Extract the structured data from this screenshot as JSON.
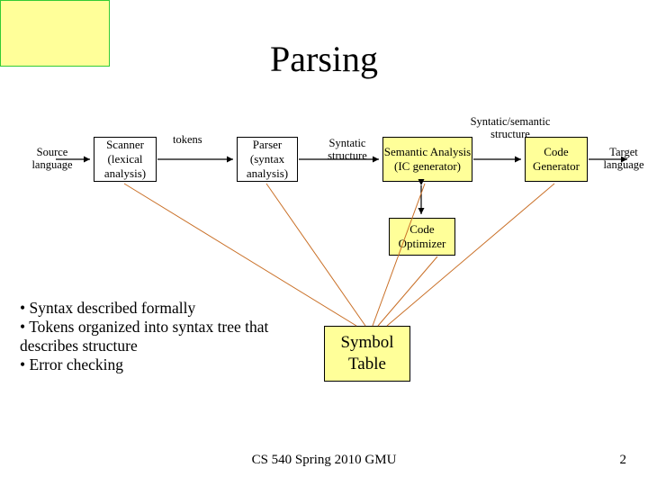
{
  "title": "Parsing",
  "labels": {
    "source": "Source language",
    "tokens": "tokens",
    "synstruct": "Syntatic structure",
    "synsem": "Syntatic/semantic structure",
    "target": "Target language"
  },
  "boxes": {
    "scanner": "Scanner (lexical analysis)",
    "parser": "Parser (syntax analysis)",
    "semantic": "Semantic Analysis (IC generator)",
    "codegen": "Code Generator",
    "optimizer": "Code Optimizer",
    "symbol": "Symbol Table"
  },
  "bullets": {
    "b1": "Syntax described formally",
    "b2": "Tokens organized into syntax tree that describes structure",
    "b3": "Error checking"
  },
  "footer": {
    "center": "CS 540 Spring 2010 GMU",
    "pagenum": "2"
  }
}
